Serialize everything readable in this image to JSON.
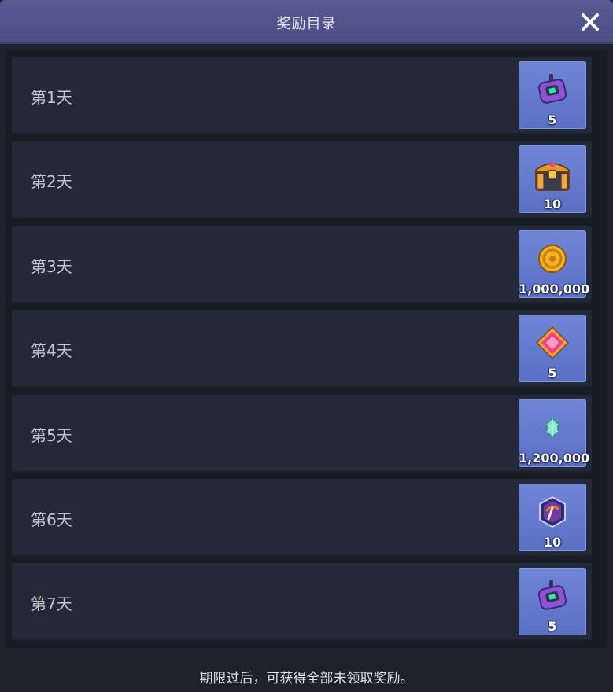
{
  "window": {
    "title": "奖励目录"
  },
  "rows": [
    {
      "day": "第1天",
      "icon": "walkie-talkie-icon",
      "quantity": "5"
    },
    {
      "day": "第2天",
      "icon": "treasure-chest-icon",
      "quantity": "10"
    },
    {
      "day": "第3天",
      "icon": "gold-coin-icon",
      "quantity": "1,000,000"
    },
    {
      "day": "第4天",
      "icon": "pink-gem-icon",
      "quantity": "5"
    },
    {
      "day": "第5天",
      "icon": "green-crystal-icon",
      "quantity": "1,200,000"
    },
    {
      "day": "第6天",
      "icon": "pickaxe-badge-icon",
      "quantity": "10"
    },
    {
      "day": "第7天",
      "icon": "walkie-talkie-icon",
      "quantity": "5"
    }
  ],
  "footer": {
    "note": "期限过后，可获得全部未领取奖励。"
  },
  "colors": {
    "titlebar": "#575a93",
    "item_slot": "#6f85d8",
    "row_bg": "#232936"
  }
}
